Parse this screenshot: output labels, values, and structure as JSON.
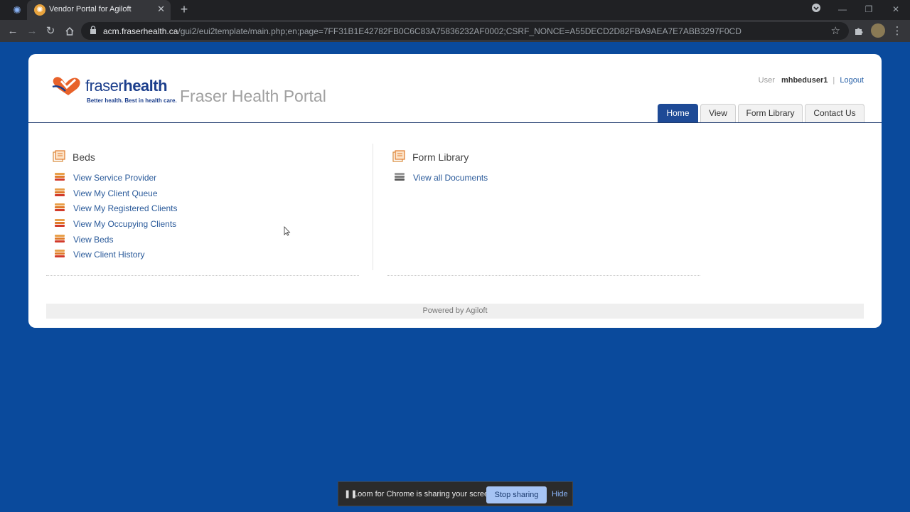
{
  "browser": {
    "tab_title": "Vendor Portal for Agiloft",
    "tab_close": "✕",
    "new_tab": "+",
    "url_host": "acm.fraserhealth.ca",
    "url_path": "/gui2/eui2template/main.php;en;page=7FF31B1E42782FB0C6C83A75836232AF0002;CSRF_NONCE=A55DECD2D82FBA9AEA7E7ABB3297F0CD",
    "icons": [
      "extension-icon",
      "back-icon",
      "forward-icon",
      "reload-icon",
      "home-icon",
      "lock-icon",
      "star-icon",
      "puzzle-icon",
      "menu-icon"
    ]
  },
  "portal": {
    "logo_text_light": "fraser",
    "logo_text_bold": "health",
    "logo_tagline": "Better health. Best in health care.",
    "title": "Fraser Health Portal",
    "user_label": "User",
    "username": "mhbeduser1",
    "separator": "|",
    "logout": "Logout"
  },
  "nav": {
    "tabs": [
      {
        "label": "Home",
        "active": true
      },
      {
        "label": "View",
        "active": false
      },
      {
        "label": "Form Library",
        "active": false
      },
      {
        "label": "Contact Us",
        "active": false
      }
    ]
  },
  "sections": {
    "beds": {
      "title": "Beds",
      "links": [
        "View Service Provider",
        "View My Client Queue",
        "View My Registered Clients",
        "View My Occupying Clients",
        "View Beds",
        "View Client History"
      ]
    },
    "form_library": {
      "title": "Form Library",
      "links": [
        "View all Documents"
      ]
    }
  },
  "footer": {
    "text": "Powered by Agiloft"
  },
  "loom": {
    "message": "Loom for Chrome is sharing your screen.",
    "stop_label": "Stop sharing",
    "hide_label": "Hide"
  },
  "colors": {
    "page_background": "#0a4a9c",
    "active_tab": "#1e4a96",
    "link": "#2a5a9a",
    "logo_orange": "#e8622a"
  }
}
